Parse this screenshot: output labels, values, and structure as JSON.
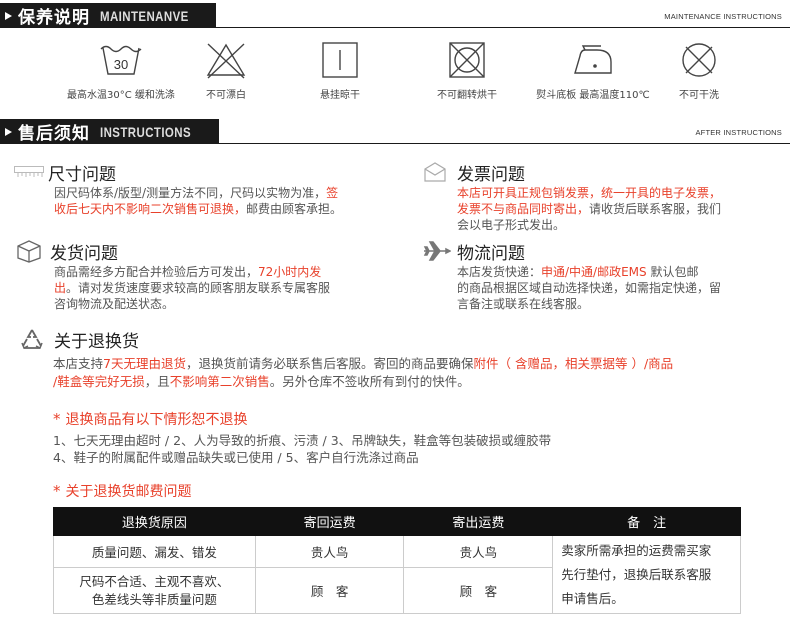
{
  "maintenance": {
    "title_cn": "保养说明",
    "title_en": "MAINTENANVE",
    "right_en": "MAINTENANCE INSTRUCTIONS",
    "symbols": [
      {
        "icon": "wash-30-icon",
        "value": "30",
        "label": "最高水温30°C 缓和洗涤"
      },
      {
        "icon": "no-bleach-icon",
        "label": "不可漂白"
      },
      {
        "icon": "hang-dry-icon",
        "label": "悬挂晾干"
      },
      {
        "icon": "no-tumble-dry-icon",
        "label": "不可翻转烘干"
      },
      {
        "icon": "iron-low-icon",
        "label": "熨斗底板 最高温度110℃"
      },
      {
        "icon": "no-dry-clean-icon",
        "label": "不可干洗"
      }
    ]
  },
  "aftersale": {
    "title_cn": "售后须知",
    "title_en": "INSTRUCTIONS",
    "right_en": "AFTER INSTRUCTIONS"
  },
  "size": {
    "title": "尺寸问题",
    "l1a": "因尺码体系/版型/测量方法不同，尺码以实物为准，",
    "l1b": "签",
    "l2a": "收后七天内不影响二次销售可退换，",
    "l2b": "邮费由顾客承担。"
  },
  "invoice": {
    "title": "发票问题",
    "l1": "本店可开具正规包销发票，统一开具的电子发票，",
    "l2a": "发票不与商品同时寄出，",
    "l2b": "请收货后联系客服，我们",
    "l3": "会以电子形式发出。"
  },
  "shipping": {
    "title": "发货问题",
    "l1a": "商品需经多方配合并检验后方可发出，",
    "l1b": "72小时内发",
    "l2a": "出",
    "l2b": "。请对发货速度要求较高的顾客朋友联系专属客服",
    "l3": "咨询物流及配送状态。"
  },
  "logistics": {
    "title": "物流问题",
    "l1a": "本店发货快递：",
    "l1b": "申通/中通/邮政EMS",
    "l1c": " 默认包邮",
    "l2": "的商品根据区域自动选择快递，如需指定快递，留",
    "l3": "言备注或联系在线客服。"
  },
  "returns": {
    "title": "关于退换货",
    "p1a": "本店支持",
    "p1b": "7天无理由退货",
    "p1c": "，退换货前请务必联系售后客服。寄回的商品要确保",
    "p1d": "附件（ 含赠品，相关票据等 ）/商品",
    "p2a": "/鞋盒等完好无损",
    "p2b": "，且",
    "p2c": "不影响第二次销售",
    "p2d": "。另外仓库不签收所有到付的快件。"
  },
  "no_return": {
    "star": "*",
    "title": "退换商品有以下情形恕不退换",
    "line1": "1、七天无理由超时  /  2、人为导致的折痕、污渍  /  3、吊牌缺失，鞋盒等包装破损或缠胶带",
    "line2": "4、鞋子的附属配件或赠品缺失或已使用  /  5、客户自行洗涤过商品"
  },
  "fee": {
    "star": "*",
    "title": "关于退换货邮费问题",
    "headers": [
      "退换货原因",
      "寄回运费",
      "寄出运费",
      "备　注"
    ],
    "rows": [
      {
        "reason": "质量问题、漏发、错发",
        "back": "贵人鸟",
        "out": "贵人鸟"
      },
      {
        "reason1": "尺码不合适、主观不喜欢、",
        "reason2": "色差线头等非质量问题",
        "back": "顾　客",
        "out": "顾　客"
      }
    ],
    "note1": "卖家所需承担的运费需买家",
    "note2": "先行垫付，退换后联系客服",
    "note3": "申请售后。"
  },
  "colors": {
    "accent_red": "#e8412b",
    "header_black": "#1a1a1a"
  }
}
